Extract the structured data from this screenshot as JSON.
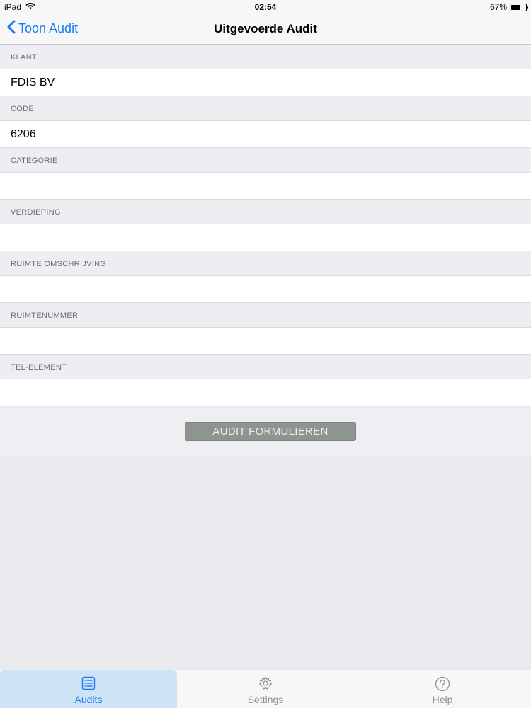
{
  "status_bar": {
    "device": "iPad",
    "time": "02:54",
    "battery": "67%",
    "battery_level": 0.67
  },
  "nav": {
    "back_label": "Toon Audit",
    "title": "Uitgevoerde Audit"
  },
  "form": {
    "fields": [
      {
        "label": "KLANT",
        "value": "FDIS BV"
      },
      {
        "label": "CODE",
        "value": "6206"
      },
      {
        "label": "CATEGORIE",
        "value": ""
      },
      {
        "label": "VERDIEPING",
        "value": ""
      },
      {
        "label": "RUIMTE OMSCHRIJVING",
        "value": ""
      },
      {
        "label": "RUIMTENUMMER",
        "value": ""
      },
      {
        "label": "TEL-ELEMENT",
        "value": ""
      }
    ],
    "button_label": "AUDIT FORMULIEREN"
  },
  "tabs": [
    {
      "label": "Audits",
      "icon": "list-icon",
      "active": true
    },
    {
      "label": "Settings",
      "icon": "gear-icon",
      "active": false
    },
    {
      "label": "Help",
      "icon": "help-icon",
      "active": false
    }
  ],
  "colors": {
    "accent": "#1a7cf4",
    "button_bg": "#8e9590",
    "active_tab_bg": "#cfe3f7"
  }
}
